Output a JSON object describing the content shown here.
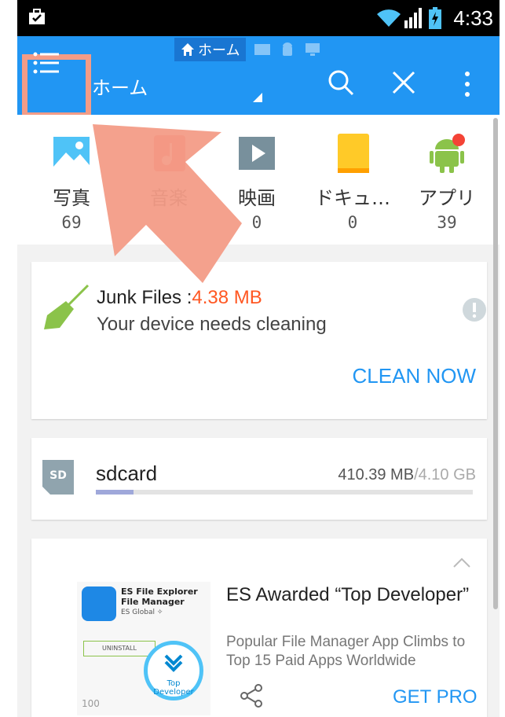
{
  "status_bar": {
    "time": "4:33"
  },
  "app_bar": {
    "window_tab_label": "ホーム",
    "title": "ホーム",
    "accent_color": "#2196f3"
  },
  "categories": [
    {
      "label": "写真",
      "count": "69",
      "icon": "image-icon"
    },
    {
      "label": "音楽",
      "count": "",
      "icon": "music-icon"
    },
    {
      "label": "映画",
      "count": "0",
      "icon": "video-icon"
    },
    {
      "label": "ドキュ…",
      "count": "0",
      "icon": "document-icon"
    },
    {
      "label": "アプリ",
      "count": "39",
      "icon": "android-icon"
    }
  ],
  "junk_card": {
    "label": "Junk Files :",
    "size": "4.38 MB",
    "message": "Your device needs cleaning",
    "action": "CLEAN NOW"
  },
  "storage_card": {
    "name": "sdcard",
    "used": "410.39 MB",
    "total": "/4.10 GB",
    "used_fraction": 0.1
  },
  "promo_card": {
    "thumb_title": "ES File Explorer File Manager",
    "thumb_publisher": "ES Global ✧",
    "thumb_button": "UNINSTALL",
    "badge_line1": "Top",
    "badge_line2": "Developer",
    "thumb_score": "100",
    "title": "ES Awarded “Top Developer”",
    "description": "Popular File Manager App Climbs to Top 15 Paid Apps Worldwide",
    "action": "GET PRO"
  }
}
